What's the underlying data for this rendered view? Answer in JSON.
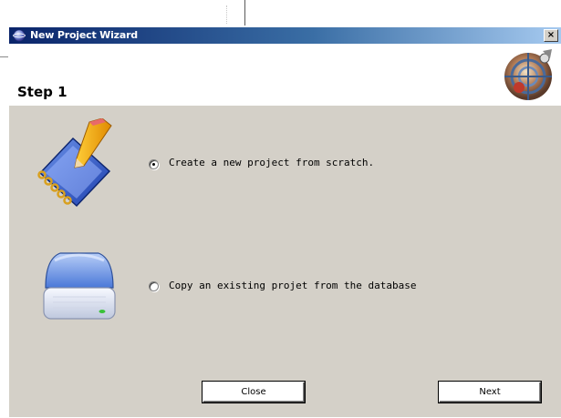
{
  "window": {
    "title": "New Project Wizard",
    "close_glyph": "×",
    "icon": "globe-icon",
    "header_logo": "radar-globe-logo-icon"
  },
  "header": {
    "step_title": "Step 1"
  },
  "options": [
    {
      "label": "Create a new project from scratch.",
      "checked": true,
      "icon": "notebook-pencil-icon"
    },
    {
      "label": "Copy an existing projet from the database",
      "checked": false,
      "icon": "hard-drive-icon"
    }
  ],
  "buttons": {
    "close_label": "Close",
    "next_label": "Next"
  },
  "colors": {
    "titlebar_start": "#0a246a",
    "titlebar_end": "#a6caf0",
    "dialog_bg": "#d4d0c8",
    "header_bg": "#ffffff"
  }
}
